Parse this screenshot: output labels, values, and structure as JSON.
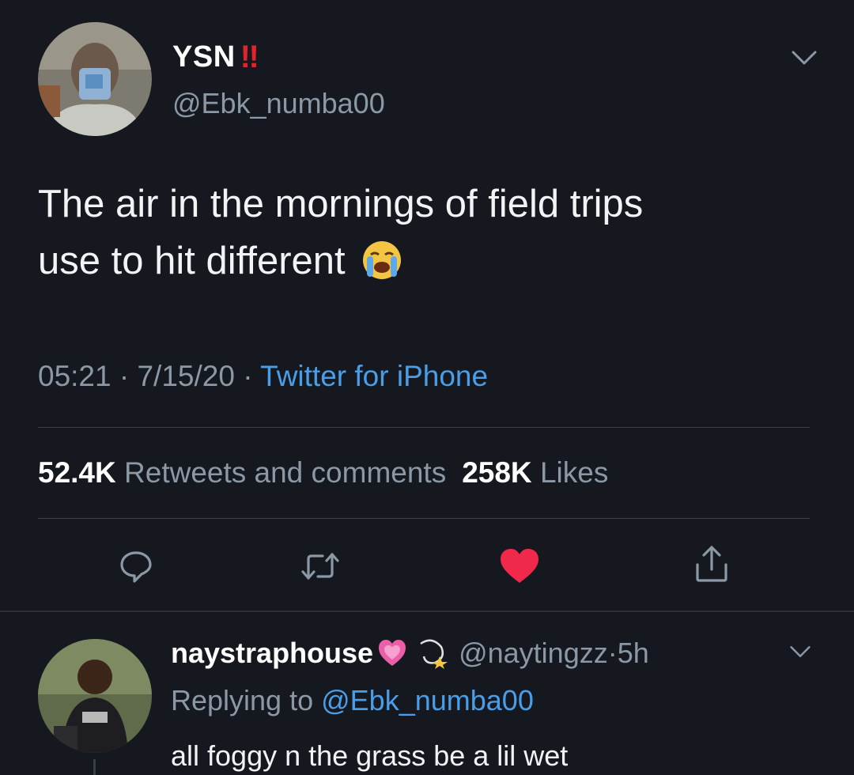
{
  "tweet": {
    "display_name": "YSN",
    "name_emoji": "‼",
    "handle": "@Ebk_numba00",
    "text_line1": "The air in the mornings of field trips",
    "text_line2": "use to hit different",
    "text_emoji": "loudly-crying-face",
    "time": "05:21",
    "date": "7/15/20",
    "source": "Twitter for iPhone",
    "retweets_count": "52.4K",
    "retweets_label": "Retweets and comments",
    "likes_count": "258K",
    "likes_label": "Likes",
    "actions": [
      "reply-icon",
      "retweet-icon",
      "like-icon",
      "share-icon"
    ],
    "liked": true
  },
  "reply": {
    "display_name": "naystraphouse",
    "name_emojis": [
      "growing-heart",
      "dizzy"
    ],
    "handle": "@naytingzz",
    "time": "5h",
    "replying_label": "Replying to",
    "replying_to": "@Ebk_numba00",
    "text": "all foggy n the grass be a lil wet"
  },
  "colors": {
    "background": "#15181f",
    "secondary_text": "#8b98a5",
    "link": "#4a9ee8",
    "like": "#f02849"
  }
}
